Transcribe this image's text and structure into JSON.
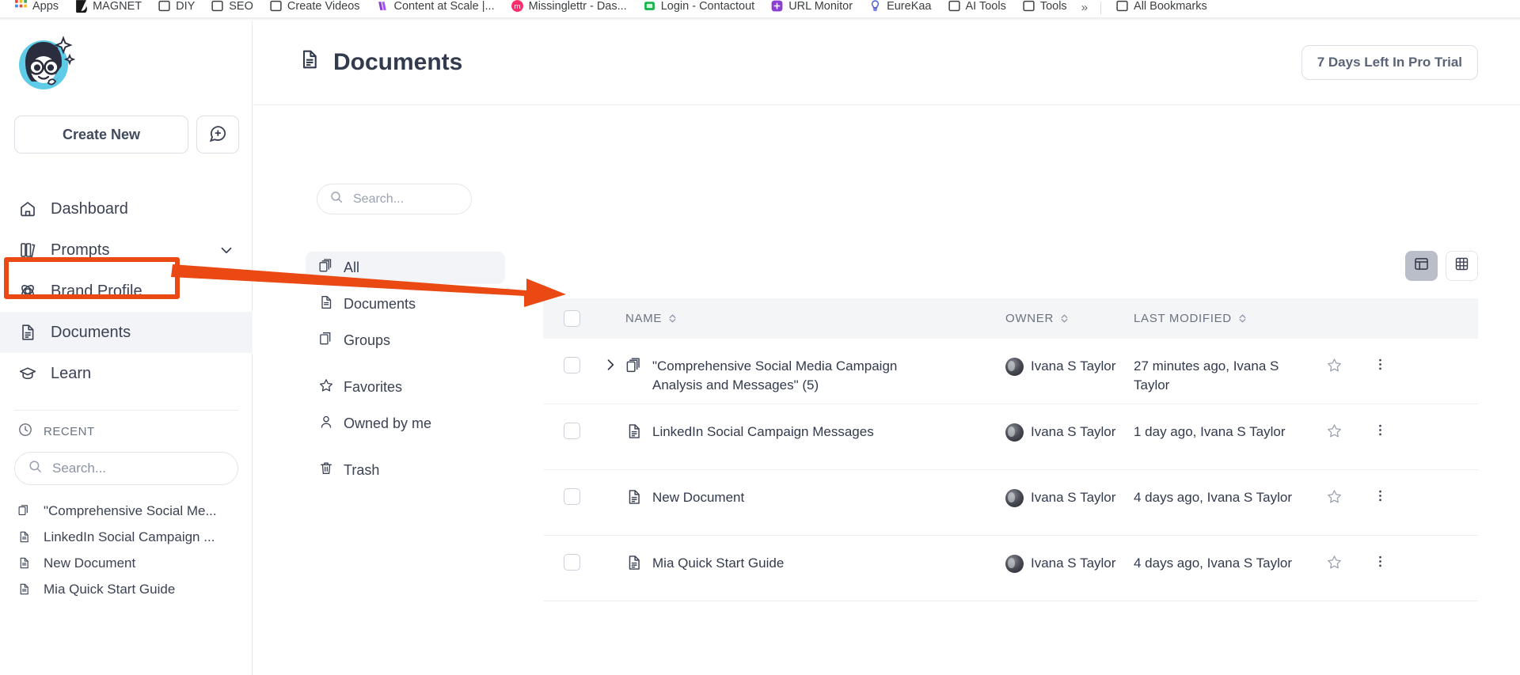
{
  "browser": {
    "bookmarks": [
      {
        "label": "Apps",
        "icon": "apps-grid-icon"
      },
      {
        "label": "MAGNET",
        "icon": "magnet-logo-icon"
      },
      {
        "label": "DIY",
        "icon": "bookmark-page-icon"
      },
      {
        "label": "SEO",
        "icon": "bookmark-page-icon"
      },
      {
        "label": "Create Videos",
        "icon": "bookmark-page-icon"
      },
      {
        "label": "Content at Scale |...",
        "icon": "content-at-scale-icon"
      },
      {
        "label": "Missinglettr - Das...",
        "icon": "missinglettr-icon"
      },
      {
        "label": "Login - Contactout",
        "icon": "contactout-icon"
      },
      {
        "label": "URL Monitor",
        "icon": "url-monitor-icon"
      },
      {
        "label": "EureKaa",
        "icon": "eurekaa-icon"
      },
      {
        "label": "AI Tools",
        "icon": "bookmark-folder-icon"
      },
      {
        "label": "Tools",
        "icon": "bookmark-folder-icon"
      }
    ],
    "overflow_label": "»",
    "all_bookmarks_label": "All Bookmarks"
  },
  "sidebar": {
    "logo_alt": "mia-mascot-logo",
    "create_new_label": "Create New",
    "chat_button_icon": "chat-plus-icon",
    "nav": [
      {
        "label": "Dashboard",
        "icon": "home-icon",
        "active": false,
        "chevron": false
      },
      {
        "label": "Prompts",
        "icon": "books-icon",
        "active": false,
        "chevron": true
      },
      {
        "label": "Brand Profile",
        "icon": "brand-atom-icon",
        "active": false,
        "chevron": false
      },
      {
        "label": "Documents",
        "icon": "document-icon",
        "active": true,
        "chevron": false
      },
      {
        "label": "Learn",
        "icon": "graduation-cap-icon",
        "active": false,
        "chevron": false
      }
    ],
    "recent": {
      "heading": "RECENT",
      "heading_icon": "clock-icon",
      "search_placeholder": "Search...",
      "search_value": "",
      "items": [
        {
          "label": "\"Comprehensive Social Me...",
          "icon": "group-docs-icon"
        },
        {
          "label": "LinkedIn Social Campaign ...",
          "icon": "document-icon"
        },
        {
          "label": "New Document",
          "icon": "document-icon"
        },
        {
          "label": "Mia Quick Start Guide",
          "icon": "document-icon"
        }
      ]
    }
  },
  "header": {
    "title": "Documents",
    "title_icon": "document-icon",
    "trial_badge": "7 Days Left In Pro Trial"
  },
  "filters": {
    "search_placeholder": "Search...",
    "search_value": "",
    "groups": [
      [
        {
          "label": "All",
          "icon": "group-docs-icon",
          "active": true
        },
        {
          "label": "Documents",
          "icon": "document-icon",
          "active": false
        },
        {
          "label": "Groups",
          "icon": "copy-docs-icon",
          "active": false
        }
      ],
      [
        {
          "label": "Favorites",
          "icon": "star-icon",
          "active": false
        },
        {
          "label": "Owned by me",
          "icon": "person-icon",
          "active": false
        }
      ],
      [
        {
          "label": "Trash",
          "icon": "trash-icon",
          "active": false
        }
      ]
    ]
  },
  "view_toggle": {
    "list_label": "list-view",
    "grid_label": "grid-view",
    "active": "list-view"
  },
  "table": {
    "columns": [
      {
        "key": "name",
        "label": "NAME",
        "sortable": true
      },
      {
        "key": "owner",
        "label": "OWNER",
        "sortable": true
      },
      {
        "key": "modified",
        "label": "LAST MODIFIED",
        "sortable": true
      }
    ],
    "rows": [
      {
        "name": "\"Comprehensive Social Media Campaign Analysis and Messages\" (5)",
        "icon": "group-docs-icon",
        "expandable": true,
        "owner": "Ivana S Taylor",
        "modified": "27 minutes ago, Ivana S Taylor",
        "starred": false
      },
      {
        "name": "LinkedIn Social Campaign Messages",
        "icon": "document-icon",
        "expandable": false,
        "owner": "Ivana S Taylor",
        "modified": "1 day ago, Ivana S Taylor",
        "starred": false
      },
      {
        "name": "New Document",
        "icon": "document-icon",
        "expandable": false,
        "owner": "Ivana S Taylor",
        "modified": "4 days ago, Ivana S Taylor",
        "starred": false
      },
      {
        "name": "Mia Quick Start Guide",
        "icon": "document-icon",
        "expandable": false,
        "owner": "Ivana S Taylor",
        "modified": "4 days ago, Ivana S Taylor",
        "starred": false
      }
    ]
  },
  "annotation": {
    "highlight_color": "#ea4913",
    "target": "Documents"
  }
}
